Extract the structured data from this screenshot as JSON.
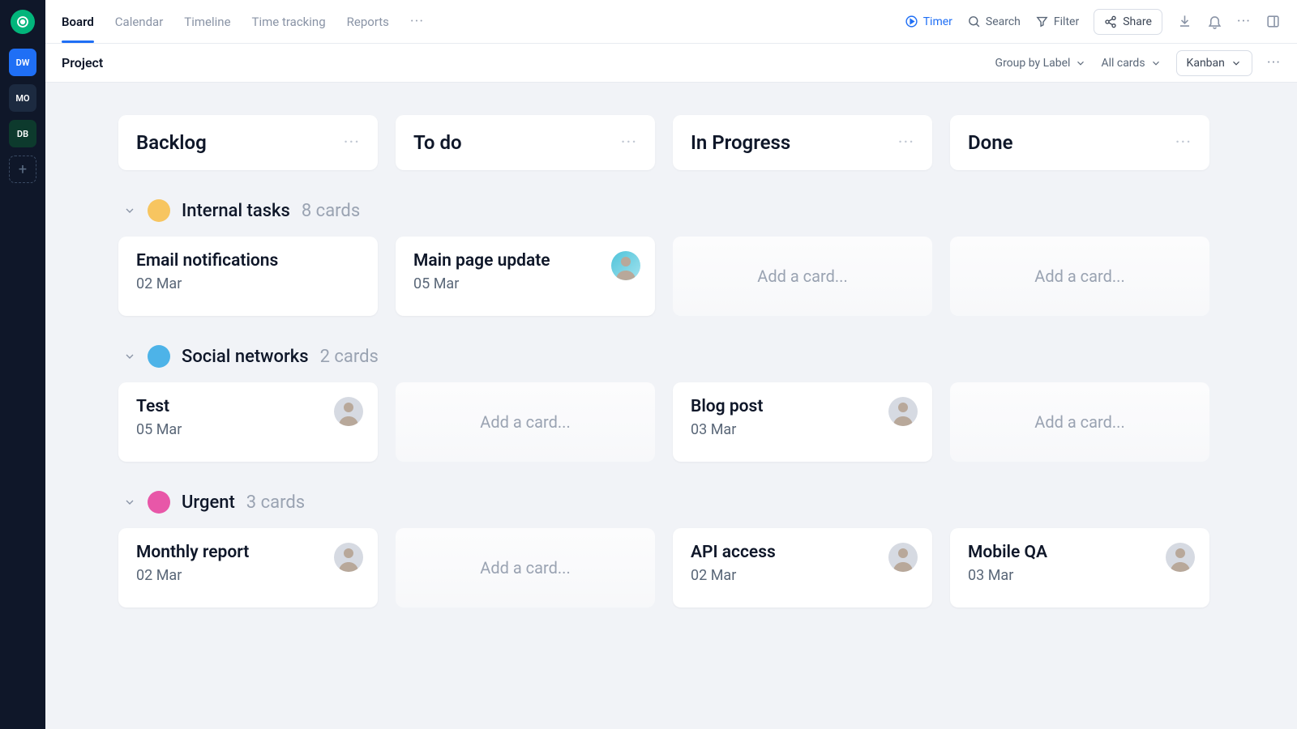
{
  "sidebar": {
    "workspaces": [
      {
        "label": "DW",
        "color": "blue"
      },
      {
        "label": "MO",
        "color": "dark"
      },
      {
        "label": "DB",
        "color": "green"
      }
    ]
  },
  "topbar": {
    "tabs": [
      "Board",
      "Calendar",
      "Timeline",
      "Time tracking",
      "Reports"
    ],
    "active_tab": 0,
    "timer": "Timer",
    "search": "Search",
    "filter": "Filter",
    "share": "Share"
  },
  "subbar": {
    "title": "Project",
    "group_by": "Group by Label",
    "cards_filter": "All cards",
    "view": "Kanban"
  },
  "columns": [
    "Backlog",
    "To do",
    "In Progress",
    "Done"
  ],
  "add_card_label": "Add a card...",
  "groups": [
    {
      "name": "Internal tasks",
      "count": "8 cards",
      "color": "orange",
      "rows": [
        [
          {
            "type": "card",
            "title": "Email notifications",
            "date": "02 Mar",
            "avatar": null
          },
          {
            "type": "card",
            "title": "Main page update",
            "date": "05 Mar",
            "avatar": "teal"
          },
          {
            "type": "add"
          },
          {
            "type": "add"
          }
        ]
      ]
    },
    {
      "name": "Social networks",
      "count": "2 cards",
      "color": "blue",
      "rows": [
        [
          {
            "type": "card",
            "title": "Test",
            "date": "05 Mar",
            "avatar": "grey"
          },
          {
            "type": "add"
          },
          {
            "type": "card",
            "title": "Blog post",
            "date": "03 Mar",
            "avatar": "grey"
          },
          {
            "type": "add"
          }
        ]
      ]
    },
    {
      "name": "Urgent",
      "count": "3 cards",
      "color": "pink",
      "rows": [
        [
          {
            "type": "card",
            "title": "Monthly report",
            "date": "02 Mar",
            "avatar": "grey"
          },
          {
            "type": "add"
          },
          {
            "type": "card",
            "title": "API access",
            "date": "02 Mar",
            "avatar": "grey"
          },
          {
            "type": "card",
            "title": "Mobile QA",
            "date": "03 Mar",
            "avatar": "grey"
          }
        ]
      ]
    }
  ]
}
